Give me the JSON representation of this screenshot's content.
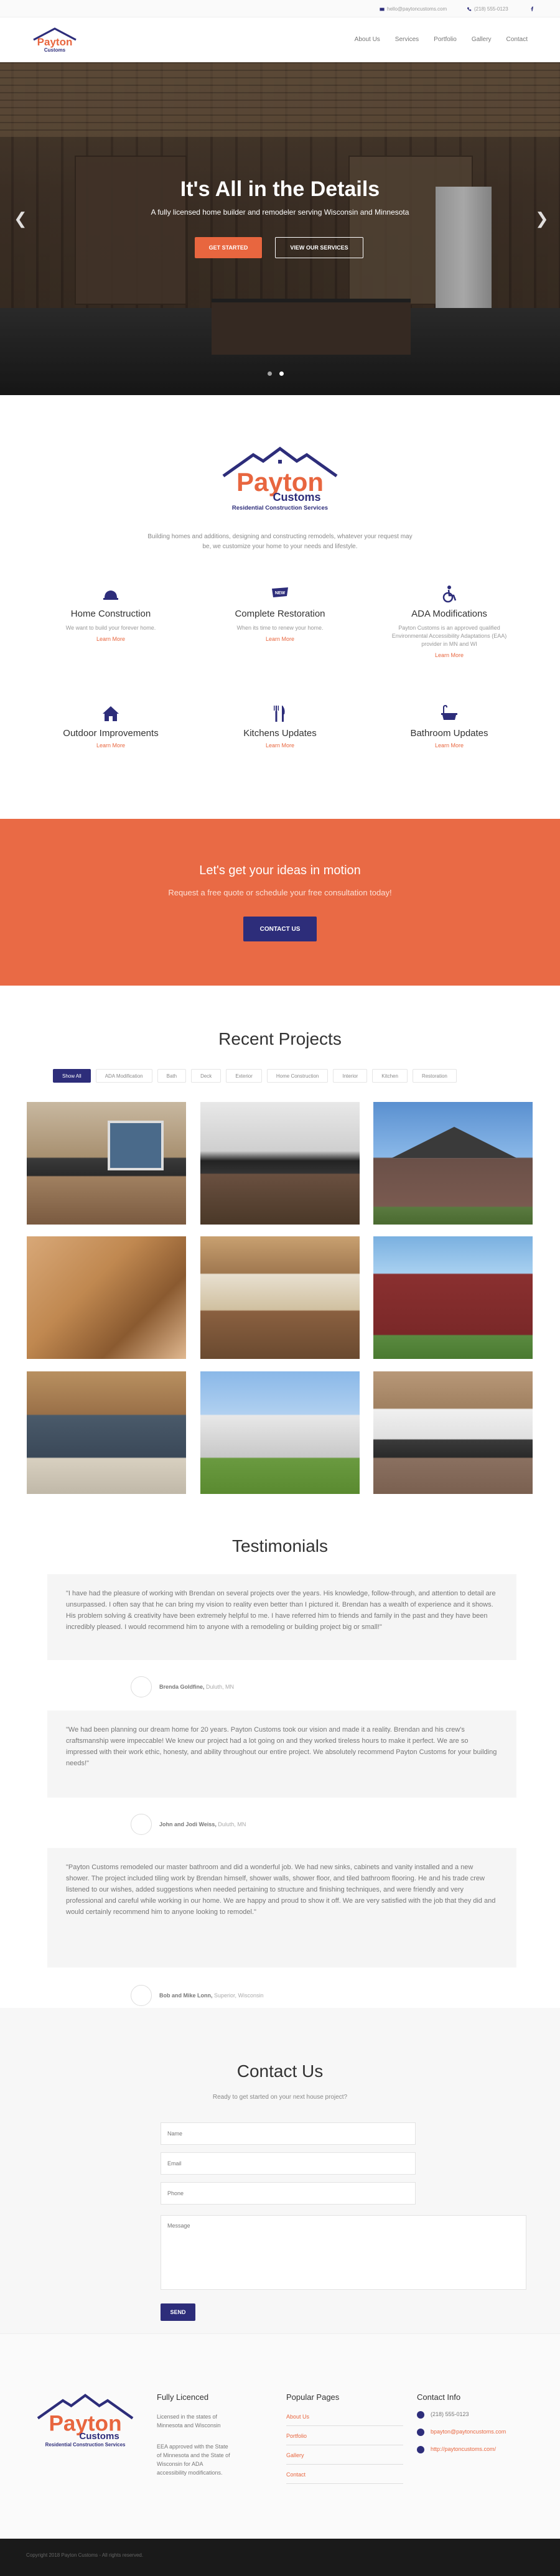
{
  "topbar": {
    "email": "hello@paytoncustoms.com",
    "phone": "(218) 555-0123"
  },
  "logo": {
    "name_top": "Payton",
    "name_bottom": "Customs",
    "tagline": "Residential Construction Services"
  },
  "nav": {
    "items": [
      "About Us",
      "Services",
      "Portfolio",
      "Gallery",
      "Contact"
    ]
  },
  "hero": {
    "title": "It's All in the Details",
    "subtitle": "A fully licensed home builder and remodeler serving Wisconsin and Minnesota",
    "primary_button": "GET STARTED",
    "secondary_button": "VIEW OUR SERVICES"
  },
  "about": {
    "text": "Building homes and additions, designing and constructing remodels, whatever your request may be, we customize your home to your needs and lifestyle."
  },
  "services": [
    {
      "title": "Home Construction",
      "text": "We want to build your forever home.",
      "link": "Learn More"
    },
    {
      "title": "Complete Restoration",
      "text": "When its time to renew your home.",
      "link": "Learn More"
    },
    {
      "title": "ADA Modifications",
      "text": "Payton Customs is an approved qualified Environmental Accessibility Adaptations (EAA) provider in MN and WI",
      "link": "Learn More"
    },
    {
      "title": "Outdoor Improvements",
      "text": "",
      "link": "Learn More"
    },
    {
      "title": "Kitchens Updates",
      "text": "",
      "link": "Learn More"
    },
    {
      "title": "Bathroom Updates",
      "text": "",
      "link": "Learn More"
    }
  ],
  "services_badge": "NEW",
  "cta": {
    "title": "Let's get your ideas in motion",
    "subtitle": "Request a free quote or schedule your free consultation today!",
    "button": "CONTACT US"
  },
  "projects": {
    "title": "Recent Projects",
    "filters": [
      "Show All",
      "ADA Modification",
      "Bath",
      "Deck",
      "Exterior",
      "Home Construction",
      "Interior",
      "Kitchen",
      "Restoration"
    ]
  },
  "testimonials": {
    "title": "Testimonials",
    "items": [
      {
        "quote": "\"I have had the pleasure of working with Brendan on several projects over the years. His knowledge, follow-through, and attention to detail are unsurpassed. I often say that he can bring my vision to reality even better than I pictured it. Brendan has a wealth of experience and it shows. His problem solving & creativity have been extremely helpful to me. I have referred him to friends and family in the past and they have been incredibly pleased. I would recommend him to anyone with a remodeling or building project big or small!\"",
        "author": "Brenda Goldfine,",
        "location": "Duluth, MN"
      },
      {
        "quote": "\"We had been planning our dream home for 20 years. Payton Customs took our vision and made it a reality. Brendan and his crew's craftsmanship were impeccable! We knew our project had a lot going on and they worked tireless hours to make it perfect. We are so impressed with their work ethic, honesty, and ability throughout our entire project. We absolutely recommend Payton Customs for your building needs!\"",
        "author": "John and Jodi Weiss,",
        "location": "Duluth, MN"
      },
      {
        "quote": "\"Payton Customs remodeled our master bathroom and did a wonderful job. We had new sinks, cabinets and vanity installed and a new shower. The project included tiling work by Brendan himself, shower walls, shower floor, and tiled bathroom flooring. He and his trade crew listened to our wishes, added suggestions when needed pertaining to structure and finishing techniques, and were friendly and very professional and careful while working in our home. We are happy and proud to show it off. We are very satisfied with the job that they did and would certainly recommend him to anyone looking to remodel.\"",
        "author": "Bob and Mike Lonn,",
        "location": "Superior, Wisconsin"
      }
    ]
  },
  "contact": {
    "title": "Contact Us",
    "subtitle": "Ready to get started on your next house project?",
    "name_placeholder": "Name",
    "email_placeholder": "Email",
    "phone_placeholder": "Phone",
    "message_placeholder": "Message",
    "send_label": "SEND"
  },
  "footer": {
    "col1_title": "Fully Licenced",
    "col1_text1": "Licensed in the states of Minnesota and Wisconsin",
    "col1_text2": "EEA approved with the State of Minnesota and the State of Wisconsin for ADA accessibility modifications.",
    "col2_title": "Popular Pages",
    "links": [
      "About Us",
      "Portfolio",
      "Gallery",
      "Contact"
    ],
    "col3_title": "Contact Info",
    "contact_phone": "(218) 555-0123",
    "contact_email": "bpayton@paytoncustoms.com",
    "contact_web": "http://paytoncustoms.com/",
    "copyright": "Copyright 2018 Payton Customs - All rights reserved."
  },
  "colors": {
    "brand_blue": "#2d2d7a",
    "brand_orange": "#e8663f"
  }
}
